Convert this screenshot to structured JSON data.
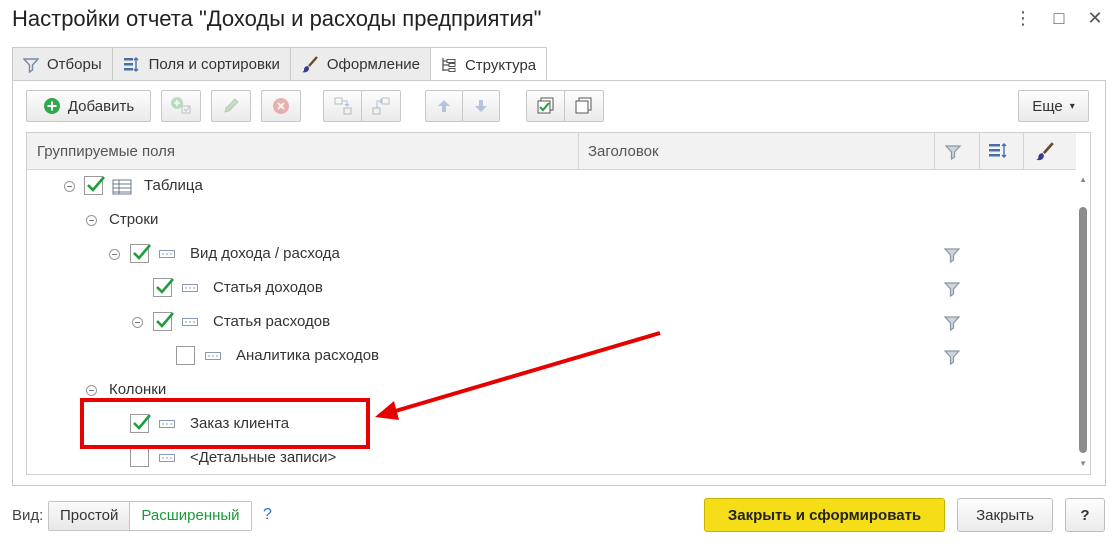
{
  "window": {
    "title": "Настройки отчета \"Доходы и расходы предприятия\"",
    "menu_icon": "⋮",
    "maximize_icon": "□",
    "close_icon": "✕"
  },
  "tabs": [
    {
      "label": "Отборы",
      "icon": "filter-icon"
    },
    {
      "label": "Поля и сортировки",
      "icon": "sort-icon"
    },
    {
      "label": "Оформление",
      "icon": "brush-icon"
    },
    {
      "label": "Структура",
      "icon": "structure-icon",
      "active": true
    }
  ],
  "toolbar": {
    "add_label": "Добавить",
    "more_label": "Еще",
    "more_arrow": "▾"
  },
  "grid": {
    "columns": [
      "Группируемые поля",
      "Заголовок"
    ],
    "rows": [
      {
        "label": "Таблица",
        "checked": true
      },
      {
        "label": "Строки"
      },
      {
        "label": "Вид дохода / расхода",
        "checked": true
      },
      {
        "label": "Статья доходов",
        "checked": true
      },
      {
        "label": "Статья расходов",
        "checked": true
      },
      {
        "label": "Аналитика расходов",
        "checked": false
      },
      {
        "label": "Колонки"
      },
      {
        "label": "Заказ клиента",
        "checked": true
      },
      {
        "label": "<Детальные записи>",
        "checked": false
      }
    ]
  },
  "footer": {
    "view_label": "Вид:",
    "view_simple": "Простой",
    "view_extended": "Расширенный",
    "help_q": "?",
    "submit_label": "Закрыть и сформировать",
    "close_label": "Закрыть",
    "help_label": "?"
  },
  "colors": {
    "check": "#1e9e3a",
    "primary": "#f5dd18",
    "highlight": "#e60000"
  }
}
